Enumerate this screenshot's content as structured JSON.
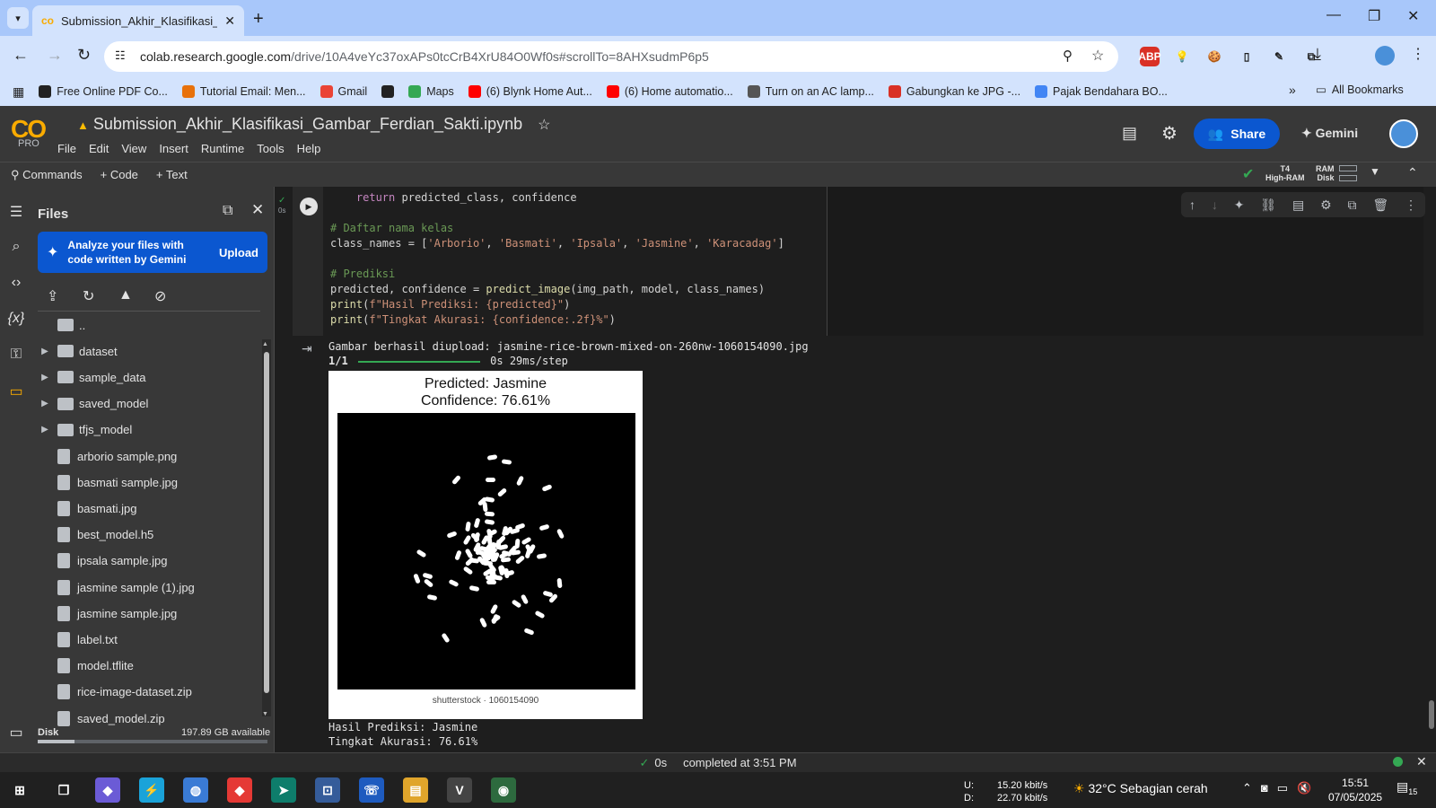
{
  "browser": {
    "tab_title": "Submission_Akhir_Klasifikasi_Ga",
    "url_domain": "colab.research.google.com",
    "url_path": "/drive/10A4veYc37oxAPs0tcCrB4XrU84O0Wf0s#scrollTo=8AHXsudmP6p5",
    "bookmarks": [
      {
        "label": "Free Online PDF Co...",
        "color": "#222222"
      },
      {
        "label": "Tutorial Email: Men...",
        "color": "#e8710a"
      },
      {
        "label": "Gmail",
        "color": "#ea4335"
      },
      {
        "label": "",
        "color": "#222222"
      },
      {
        "label": "Maps",
        "color": "#34a853"
      },
      {
        "label": "(6) Blynk Home Aut...",
        "color": "#ff0000"
      },
      {
        "label": "(6) Home automatio...",
        "color": "#ff0000"
      },
      {
        "label": "Turn on an AC lamp...",
        "color": "#555555"
      },
      {
        "label": "Gabungkan ke JPG -...",
        "color": "#d93025"
      },
      {
        "label": "Pajak Bendahara BO...",
        "color": "#4285f4"
      }
    ],
    "all_bookmarks": "All Bookmarks",
    "extensions": [
      {
        "label": "ABP",
        "color": "#d93025"
      },
      {
        "label": "💡",
        "color": "#d3e3fd"
      },
      {
        "label": "🍪",
        "color": "#d3e3fd"
      },
      {
        "label": "▯",
        "color": "#d3e3fd"
      },
      {
        "label": "✎",
        "color": "#d3e3fd"
      },
      {
        "label": "⧉",
        "color": "#d3e3fd"
      }
    ]
  },
  "colab": {
    "logo": "CO",
    "plan": "PRO",
    "notebook_title": "Submission_Akhir_Klasifikasi_Gambar_Ferdian_Sakti.ipynb",
    "menu": [
      "File",
      "Edit",
      "View",
      "Insert",
      "Runtime",
      "Tools",
      "Help"
    ],
    "share_label": "Share",
    "gemini_label": "Gemini",
    "commands_label": "Commands",
    "add_code_label": "+ Code",
    "add_text_label": "+ Text",
    "runtime_gpu": "T4",
    "runtime_type": "High-RAM",
    "ram_label": "RAM",
    "disk_label": "Disk"
  },
  "files_panel": {
    "title": "Files",
    "gemini_prompt": "Analyze your files with code written by Gemini",
    "upload_label": "Upload",
    "parent_dir": "..",
    "items": [
      {
        "name": "dataset",
        "kind": "folder"
      },
      {
        "name": "sample_data",
        "kind": "folder"
      },
      {
        "name": "saved_model",
        "kind": "folder"
      },
      {
        "name": "tfjs_model",
        "kind": "folder"
      },
      {
        "name": "arborio sample.png",
        "kind": "file"
      },
      {
        "name": "basmati sample.jpg",
        "kind": "file"
      },
      {
        "name": "basmati.jpg",
        "kind": "file"
      },
      {
        "name": "best_model.h5",
        "kind": "file"
      },
      {
        "name": "ipsala sample.jpg",
        "kind": "file"
      },
      {
        "name": "jasmine sample (1).jpg",
        "kind": "file"
      },
      {
        "name": "jasmine sample.jpg",
        "kind": "file"
      },
      {
        "name": "label.txt",
        "kind": "file"
      },
      {
        "name": "model.tflite",
        "kind": "file"
      },
      {
        "name": "rice-image-dataset.zip",
        "kind": "file"
      },
      {
        "name": "saved_model.zip",
        "kind": "file"
      }
    ],
    "disk_label": "Disk",
    "disk_available": "197.89 GB available",
    "disk_used_fraction": 0.16
  },
  "cell": {
    "exec_time": "0s",
    "code_lines": [
      "    return predicted_class, confidence",
      "",
      "# Daftar nama kelas",
      "class_names = ['Arborio', 'Basmati', 'Ipsala', 'Jasmine', 'Karacadag']",
      "",
      "# Prediksi",
      "predicted, confidence = predict_image(img_path, model, class_names)",
      "print(f\"Hasil Prediksi: {predicted}\")",
      "print(f\"Tingkat Akurasi: {confidence:.2f}%\")"
    ],
    "output_upload": "Gambar berhasil diupload: jasmine-rice-brown-mixed-on-260nw-1060154090.jpg",
    "output_progress_step": "1/1",
    "output_progress_time": "0s 29ms/step",
    "plot_title_line1": "Predicted: Jasmine",
    "plot_title_line2": "Confidence: 76.61%",
    "plot_watermark": "shutterstock · 1060154090",
    "result_line1": "Hasil Prediksi: Jasmine",
    "result_line2": "Tingkat Akurasi: 76.61%"
  },
  "status": {
    "time": "0s",
    "message": "completed at 3:51 PM"
  },
  "taskbar": {
    "net_up_label": "U:",
    "net_up": "15.20 kbit/s",
    "net_down_label": "D:",
    "net_down": "22.70 kbit/s",
    "temperature": "32°C",
    "weather": "Sebagian cerah",
    "time": "15:51",
    "date": "07/05/2025",
    "notifications": "15",
    "apps": [
      {
        "name": "start",
        "glyph": "⊞",
        "color": "#202020"
      },
      {
        "name": "task-view",
        "glyph": "❐",
        "color": "#202020"
      },
      {
        "name": "copilot",
        "glyph": "◆",
        "color": "#6b5bd6"
      },
      {
        "name": "power",
        "glyph": "⚡",
        "color": "#1aa3d9"
      },
      {
        "name": "app-globe",
        "glyph": "◍",
        "color": "#3a7bd5"
      },
      {
        "name": "anydesk",
        "glyph": "◆",
        "color": "#e53935"
      },
      {
        "name": "arrow-app",
        "glyph": "➤",
        "color": "#0e7d6b"
      },
      {
        "name": "network-app",
        "glyph": "⊡",
        "color": "#355c9a"
      },
      {
        "name": "phone-app",
        "glyph": "☏",
        "color": "#1e5bbf"
      },
      {
        "name": "file-explorer",
        "glyph": "▤",
        "color": "#e0a52b"
      },
      {
        "name": "vnc-viewer",
        "glyph": "V",
        "color": "#444444"
      },
      {
        "name": "chrome",
        "glyph": "◉",
        "color": "#2d6a3e"
      }
    ]
  }
}
